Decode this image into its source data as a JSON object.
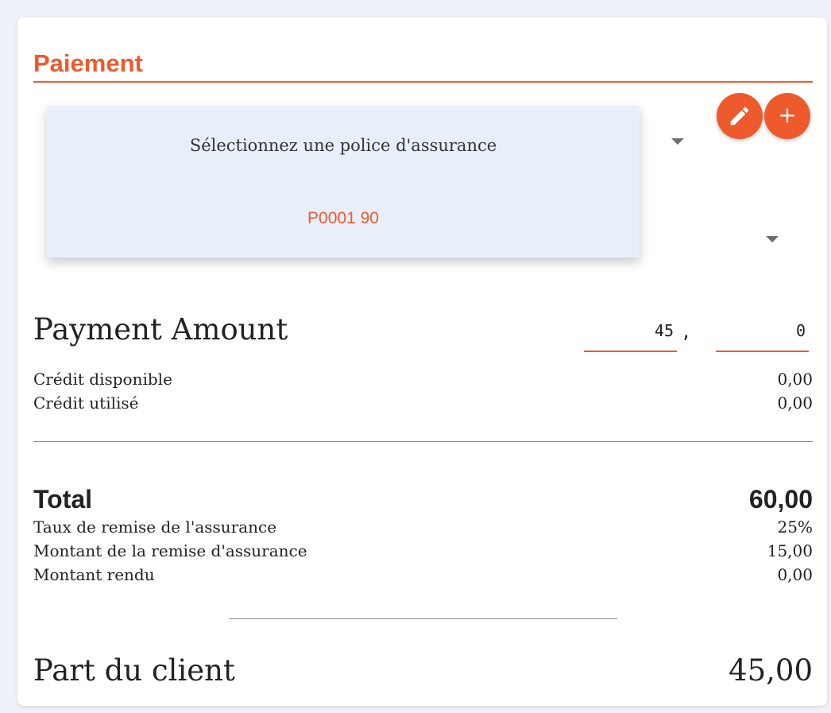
{
  "section": {
    "title": "Paiement"
  },
  "insurance_dropdown": {
    "placeholder": "Sélectionnez une police d'assurance",
    "options": [
      "P0001 90"
    ]
  },
  "actions": {
    "edit_icon": "pencil-icon",
    "add_icon": "plus-icon",
    "add_symbol": "+"
  },
  "payment": {
    "label": "Payment Amount",
    "amount_integer": "45",
    "separator": ",",
    "amount_decimal": "0"
  },
  "credit": {
    "available_label": "Crédit disponible",
    "available_value": "0,00",
    "used_label": "Crédit utilisé",
    "used_value": "0,00"
  },
  "summary": {
    "total_label": "Total",
    "total_value": "60,00",
    "discount_rate_label": "Taux de remise de l'assurance",
    "discount_rate_value": "25%",
    "discount_amount_label": "Montant de la remise d'assurance",
    "discount_amount_value": "15,00",
    "returned_label": "Montant rendu",
    "returned_value": "0,00",
    "client_share_label": "Part du client",
    "client_share_value": "45,00"
  },
  "colors": {
    "accent": "#ee5a2b",
    "dropdown_background": "#e9eff8",
    "page_background": "#eef1f7"
  }
}
